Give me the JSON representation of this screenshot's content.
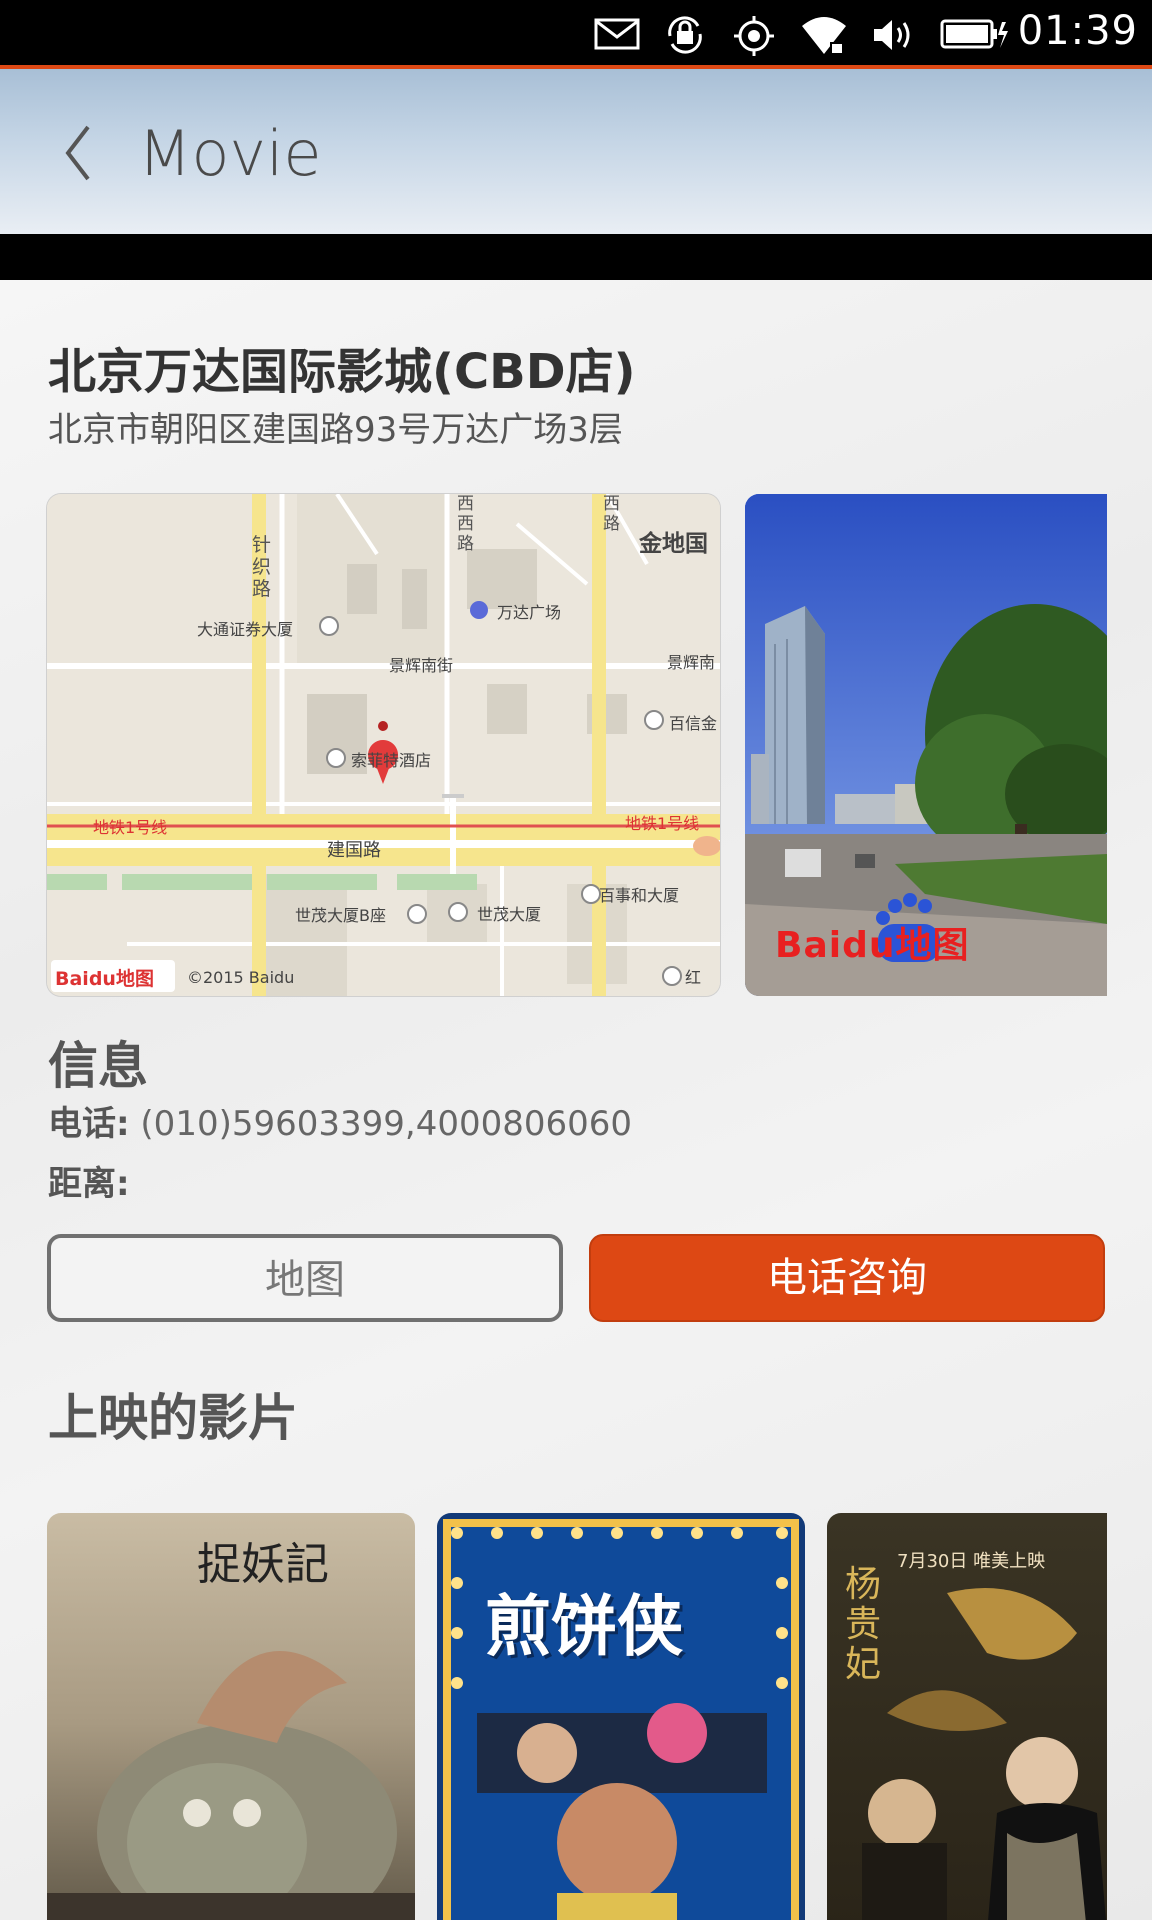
{
  "status_bar": {
    "time": "01:39",
    "icons": [
      "mail-icon",
      "rotation-lock-icon",
      "location-icon",
      "wifi-icon",
      "volume-icon",
      "battery-icon"
    ]
  },
  "header": {
    "title": "Movie"
  },
  "cinema": {
    "name": "北京万达国际影城(CBD店)",
    "address": "北京市朝阳区建国路93号万达广场3层"
  },
  "map": {
    "labels": {
      "road_1": "针织路",
      "road_2": "西西路",
      "road_3": "西路",
      "jindiguo": "金地国",
      "datong": "大通证券大厦",
      "wanda": "万达广场",
      "jinghui": "景辉南街",
      "jinghui2": "景辉南",
      "baixin": "百信金",
      "sofitel": "索菲特酒店",
      "metro_left": "地铁1号线",
      "metro_right": "地铁1号线",
      "jianguo": "建国路",
      "shimao_b": "世茂大厦B座",
      "shimao": "世茂大厦",
      "baishihe": "百事和大厦",
      "hong": "红",
      "copyright": "©2015 Baidu",
      "logo": "Baidu地图"
    }
  },
  "street_view": {
    "logo": "Baidu地图"
  },
  "info": {
    "heading": "信息",
    "phone_label": "电话:",
    "phone_value": "(010)59603399,4000806060",
    "distance_label": "距离:",
    "distance_value": ""
  },
  "buttons": {
    "map_label": "地图",
    "call_label": "电话咨询"
  },
  "movies": {
    "heading": "上映的影片",
    "posters": [
      {
        "title": "捉妖記"
      },
      {
        "title": "煎饼侠"
      },
      {
        "title": "杨贵妃",
        "tagline": "7月30日 唯美上映"
      }
    ]
  },
  "colors": {
    "accent": "#dd4814",
    "header_top": "#a8bfd6",
    "text_dark": "#333333"
  }
}
